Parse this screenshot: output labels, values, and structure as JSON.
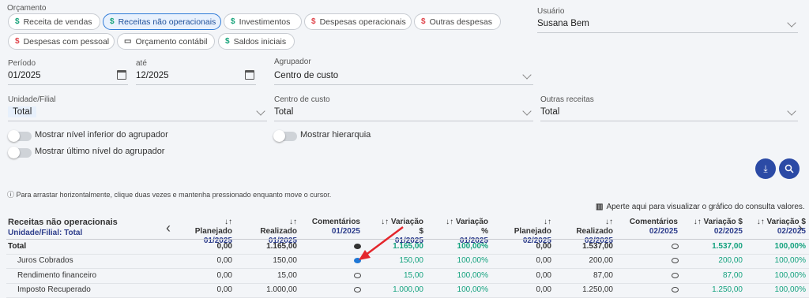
{
  "orcamento": {
    "label": "Orçamento",
    "chips": [
      {
        "label": "Receita de vendas",
        "symbol": "$"
      },
      {
        "label": "Receitas não operacionais",
        "symbol": "$"
      },
      {
        "label": "Investimentos",
        "symbol": "$"
      },
      {
        "label": "Despesas operacionais",
        "symbol": "$"
      },
      {
        "label": "Outras despesas",
        "symbol": "$"
      },
      {
        "label": "Despesas com pessoal",
        "symbol": "$"
      },
      {
        "label": "Orçamento contábil",
        "symbol": "▭"
      },
      {
        "label": "Saldos iniciais",
        "symbol": "$"
      }
    ]
  },
  "usuario": {
    "label": "Usuário",
    "value": "Susana Bem"
  },
  "periodo": {
    "label": "Período",
    "from": "01/2025",
    "to_label": "até",
    "to": "12/2025"
  },
  "agrupador": {
    "label": "Agrupador",
    "value": "Centro de custo"
  },
  "unidade": {
    "label": "Unidade/Filial",
    "value": "Total"
  },
  "centro": {
    "label": "Centro de custo",
    "value": "Total"
  },
  "outras": {
    "label": "Outras receitas",
    "value": "Total"
  },
  "toggles": {
    "nivel_inferior": "Mostrar nível inferior do agrupador",
    "ultimo_nivel": "Mostrar último nível do agrupador",
    "hierarquia": "Mostrar hierarquia"
  },
  "hint": "ⓘ Para arrastar horizontalmente, clique duas vezes e mantenha pressionado enquanto move o cursor.",
  "chart_link": "Aperte aqui para visualizar o gráfico do consulta valores.",
  "table": {
    "title": "Receitas não operacionais",
    "subtitle": "Unidade/Filial: Total",
    "headers": [
      {
        "name": "↓↑ Planejado",
        "period": "01/2025"
      },
      {
        "name": "↓↑ Realizado",
        "period": "01/2025"
      },
      {
        "name": "Comentários",
        "period": "01/2025"
      },
      {
        "name": "↓↑ Variação $",
        "period": "01/2025"
      },
      {
        "name": "↓↑ Variação %",
        "period": "01/2025"
      },
      {
        "name": "↓↑ Planejado",
        "period": "02/2025"
      },
      {
        "name": "↓↑ Realizado",
        "period": "02/2025"
      },
      {
        "name": "Comentários",
        "period": "02/2025"
      },
      {
        "name": "↓↑ Variação $",
        "period": "02/2025"
      },
      {
        "name": "↓↑ Variação $",
        "period": "02/2025"
      }
    ],
    "rows": [
      {
        "label": "Total",
        "v": [
          "0,00",
          "1.165,00",
          "",
          "1.165,00",
          "100,00%",
          "0,00",
          "1.537,00",
          "",
          "1.537,00",
          "100,00%"
        ]
      },
      {
        "label": "Juros Cobrados",
        "v": [
          "0,00",
          "150,00",
          "",
          "150,00",
          "100,00%",
          "0,00",
          "200,00",
          "",
          "200,00",
          "100,00%"
        ]
      },
      {
        "label": "Rendimento financeiro",
        "v": [
          "0,00",
          "15,00",
          "",
          "15,00",
          "100,00%",
          "0,00",
          "87,00",
          "",
          "87,00",
          "100,00%"
        ]
      },
      {
        "label": "Imposto Recuperado",
        "v": [
          "0,00",
          "1.000,00",
          "",
          "1.000,00",
          "100,00%",
          "0,00",
          "1.250,00",
          "",
          "1.250,00",
          "100,00%"
        ]
      }
    ]
  }
}
